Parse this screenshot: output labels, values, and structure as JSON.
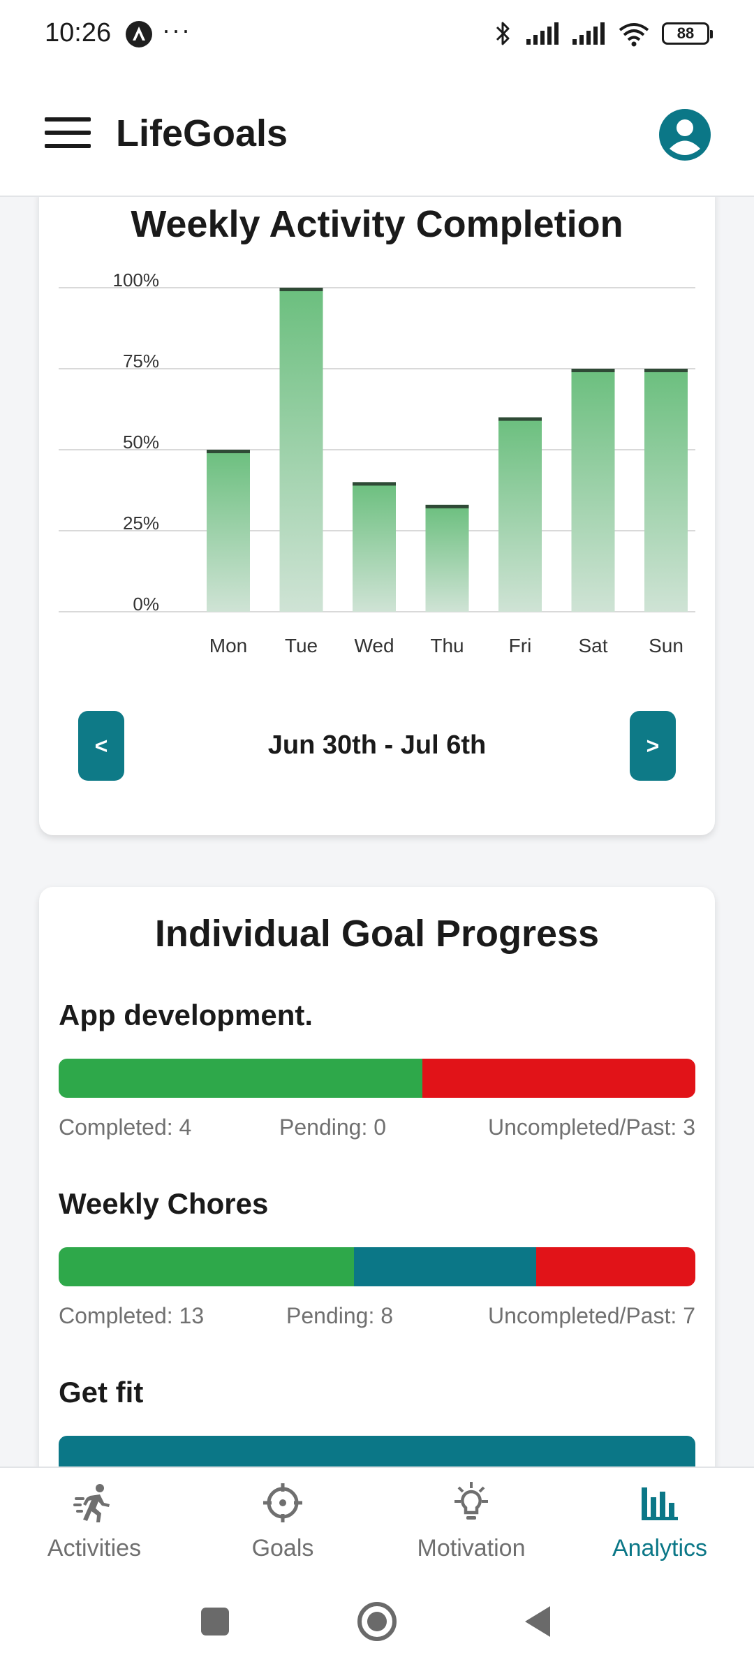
{
  "status_bar": {
    "time": "10:26",
    "more": "···",
    "battery": "88",
    "icons": [
      "app-badge-icon",
      "bluetooth-icon",
      "signal-icon",
      "signal-icon",
      "wifi-icon",
      "battery-icon"
    ]
  },
  "app_bar": {
    "title": "LifeGoals",
    "menu_icon": "menu-icon",
    "account_icon": "account-icon"
  },
  "weekly_card": {
    "title": "Weekly Activity Completion",
    "prev_label": "<",
    "next_label": ">",
    "week_range": "Jun 30th - Jul 6th"
  },
  "chart_data": {
    "type": "bar",
    "title": "Weekly Activity Completion",
    "xlabel": "",
    "ylabel": "",
    "categories": [
      "Mon",
      "Tue",
      "Wed",
      "Thu",
      "Fri",
      "Sat",
      "Sun"
    ],
    "values": [
      50,
      100,
      40,
      33,
      60,
      75,
      75
    ],
    "ylim": [
      0,
      100
    ],
    "y_ticks": [
      "0%",
      "25%",
      "50%",
      "75%",
      "100%"
    ],
    "y_tick_values": [
      0,
      25,
      50,
      75,
      100
    ],
    "grid": true,
    "legend": "none",
    "colors": {
      "bar_top": "#6bbf7e",
      "bar_bottom": "#cfe3d5",
      "bar_cap": "#2f4a36"
    }
  },
  "goals_card": {
    "title": "Individual Goal Progress",
    "goals": [
      {
        "name": "App development.",
        "completed": 4,
        "pending": 0,
        "uncompleted": 3,
        "completed_label": "Completed: 4",
        "pending_label": "Pending: 0",
        "uncompleted_label": "Uncompleted/Past: 3"
      },
      {
        "name": "Weekly Chores",
        "completed": 13,
        "pending": 8,
        "uncompleted": 7,
        "completed_label": "Completed: 13",
        "pending_label": "Pending: 8",
        "uncompleted_label": "Uncompleted/Past: 7"
      },
      {
        "name": "Get fit",
        "completed": 0,
        "pending": 1,
        "uncompleted": 0
      }
    ],
    "colors": {
      "completed": "#2ea84a",
      "pending": "#0b7787",
      "uncompleted": "#e11318"
    }
  },
  "bottom_nav": {
    "items": [
      {
        "label": "Activities",
        "icon": "running-icon",
        "active": false
      },
      {
        "label": "Goals",
        "icon": "target-icon",
        "active": false
      },
      {
        "label": "Motivation",
        "icon": "lightbulb-icon",
        "active": false
      },
      {
        "label": "Analytics",
        "icon": "bar-chart-icon",
        "active": true
      }
    ],
    "accent": "#0b7787"
  },
  "system_nav": {
    "icons": [
      "recents-icon",
      "home-icon",
      "back-icon"
    ]
  }
}
